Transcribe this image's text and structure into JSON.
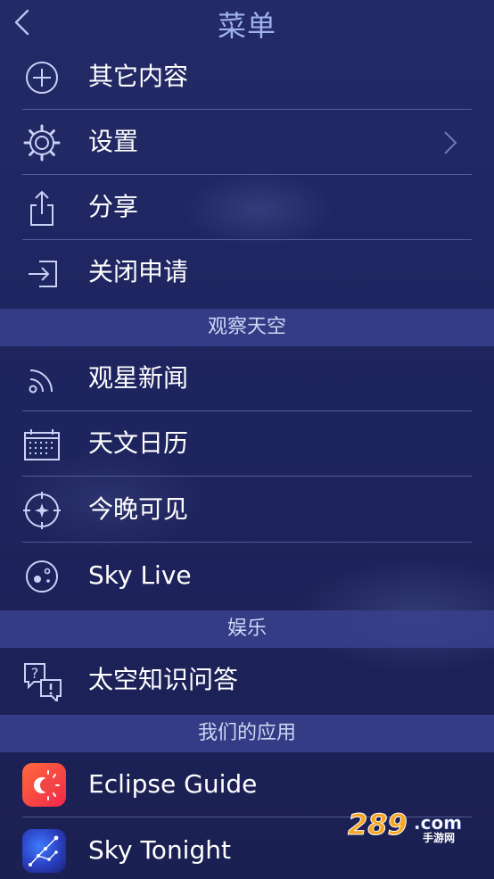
{
  "header": {
    "title": "菜单"
  },
  "menu": [
    {
      "label": "其它内容",
      "icon": "plus-circle-icon"
    },
    {
      "label": "设置",
      "icon": "gear-icon",
      "chevron": true
    },
    {
      "label": "分享",
      "icon": "share-icon"
    },
    {
      "label": "关闭申请",
      "icon": "exit-icon"
    }
  ],
  "sections": {
    "observe": "观察天空",
    "fun": "娱乐",
    "apps": "我们的应用"
  },
  "observe_items": [
    {
      "label": "观星新闻",
      "icon": "rss-icon"
    },
    {
      "label": "天文日历",
      "icon": "calendar-icon"
    },
    {
      "label": "今晚可见",
      "icon": "star-target-icon"
    },
    {
      "label": "Sky Live",
      "icon": "planet-icon"
    }
  ],
  "fun_items": [
    {
      "label": "太空知识问答",
      "icon": "quiz-icon"
    }
  ],
  "apps_items": [
    {
      "label": "Eclipse Guide",
      "icon": "eclipse-guide-app-icon"
    },
    {
      "label": "Sky Tonight",
      "icon": "sky-tonight-app-icon"
    }
  ],
  "watermark": {
    "text": "289",
    "suffix": ".com",
    "sub": "手游网"
  },
  "colors": {
    "accent": "#9fb1ef",
    "section_bg": "#37418c",
    "background": "#1e2358"
  }
}
